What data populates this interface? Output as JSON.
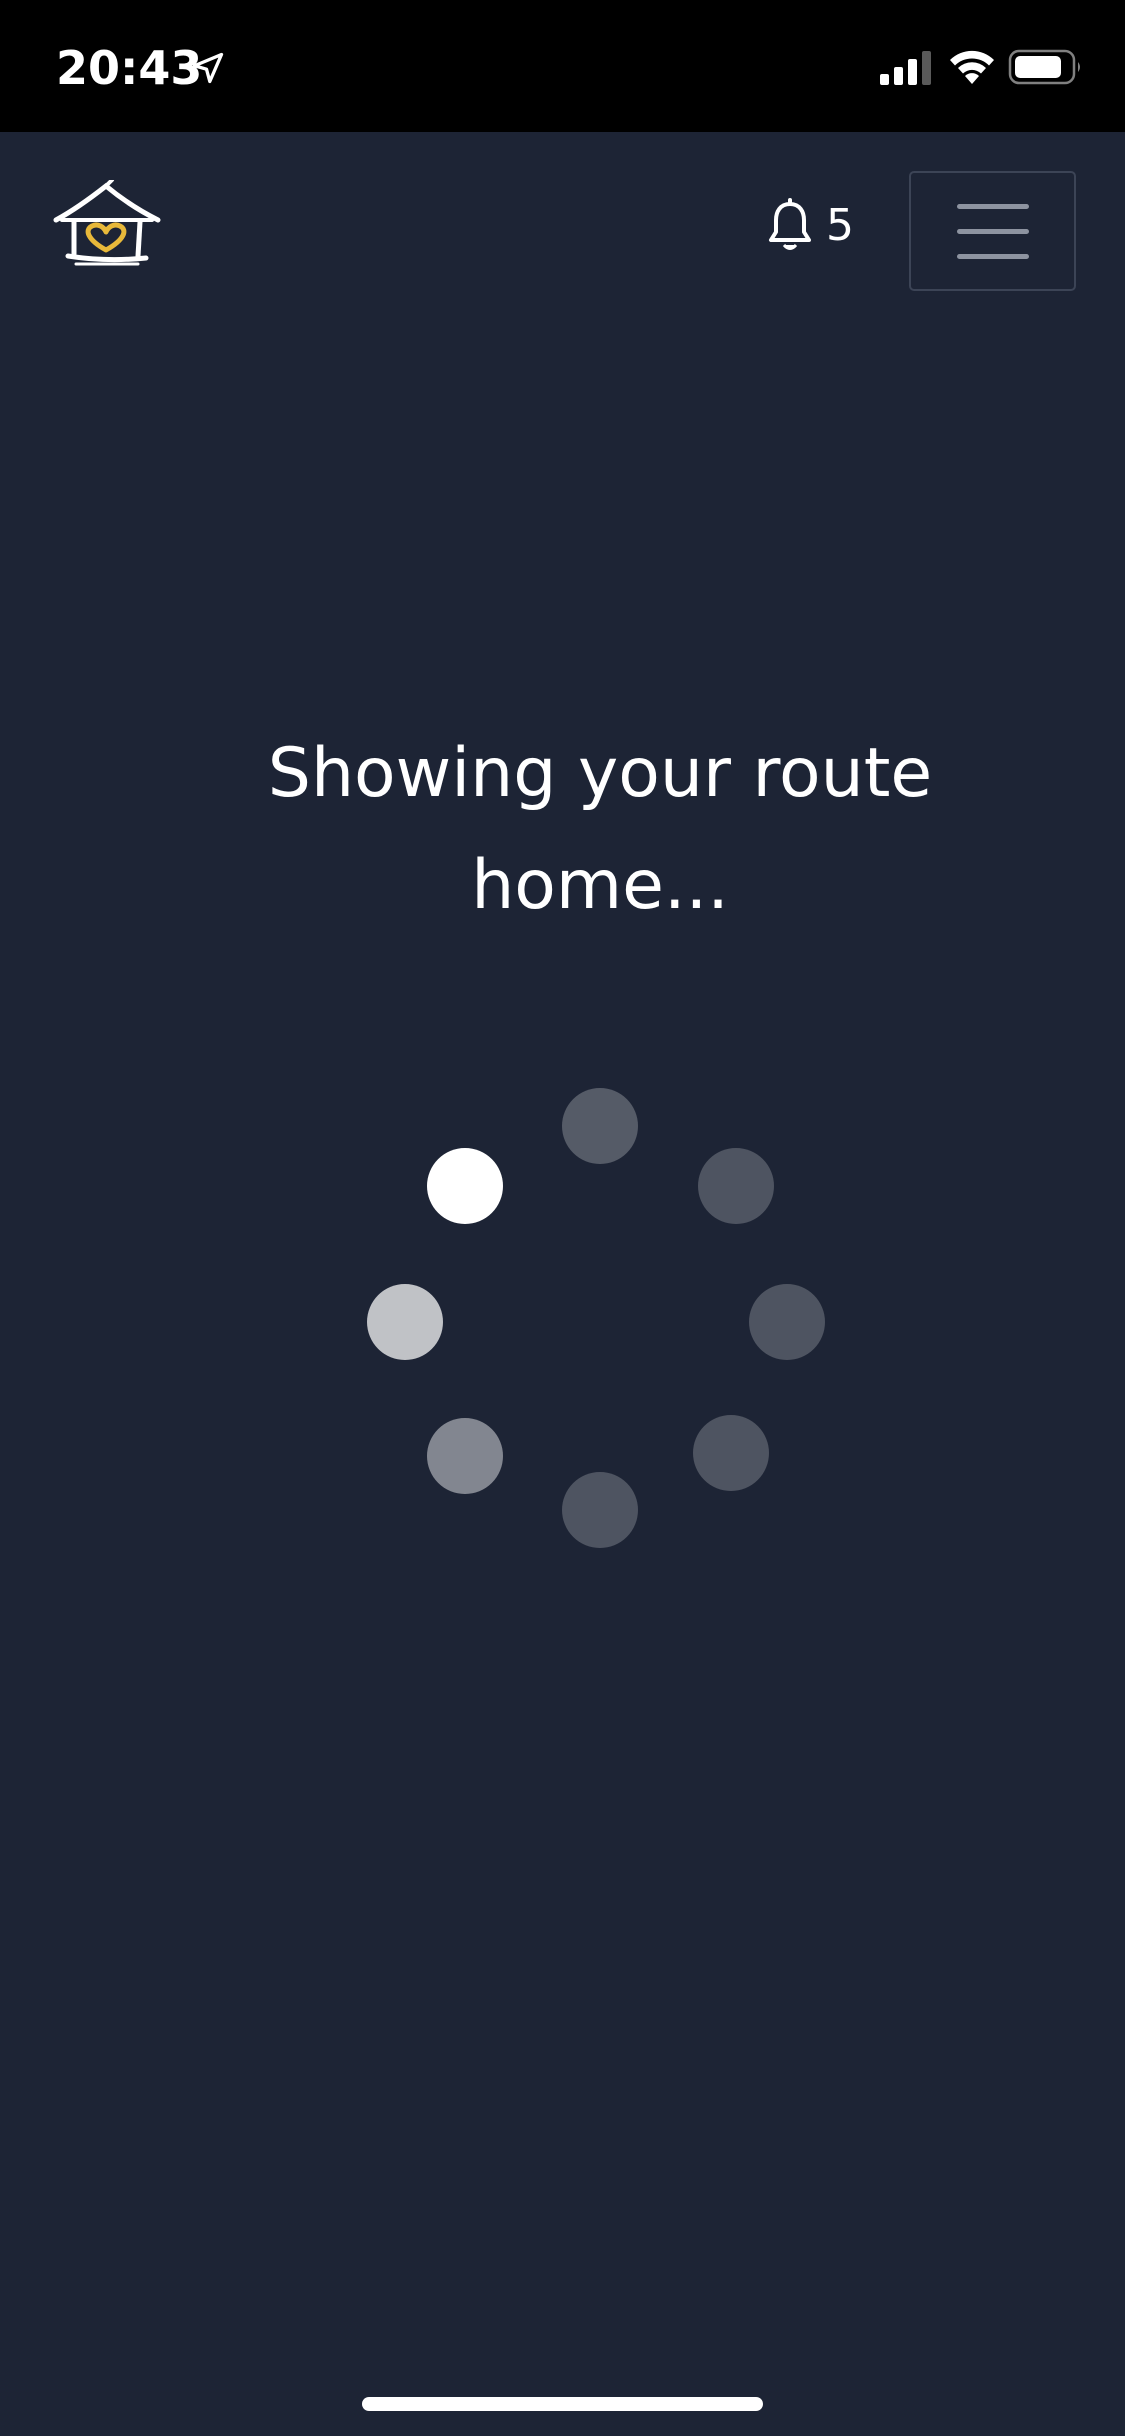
{
  "status_bar": {
    "time": "20:43",
    "icons": [
      "location-arrow-icon",
      "cellular-signal-icon",
      "wifi-icon",
      "battery-icon"
    ]
  },
  "header": {
    "logo": "house-heart-logo",
    "notifications": {
      "icon": "bell-icon",
      "count": "5"
    },
    "menu_icon": "hamburger-menu-icon"
  },
  "main": {
    "loading_message": "Showing your route home..."
  },
  "spinner": {
    "dot_count": 8,
    "active_dot": "top-left",
    "dot_opacities": [
      0.25,
      0.22,
      0.22,
      0.22,
      0.22,
      0.45,
      0.72,
      1.0
    ]
  },
  "colors": {
    "background": "#1d2435",
    "status_bar": "#000000",
    "text": "#ffffff",
    "logo_heart": "#e8b93a",
    "menu_border": "#3c4456"
  }
}
